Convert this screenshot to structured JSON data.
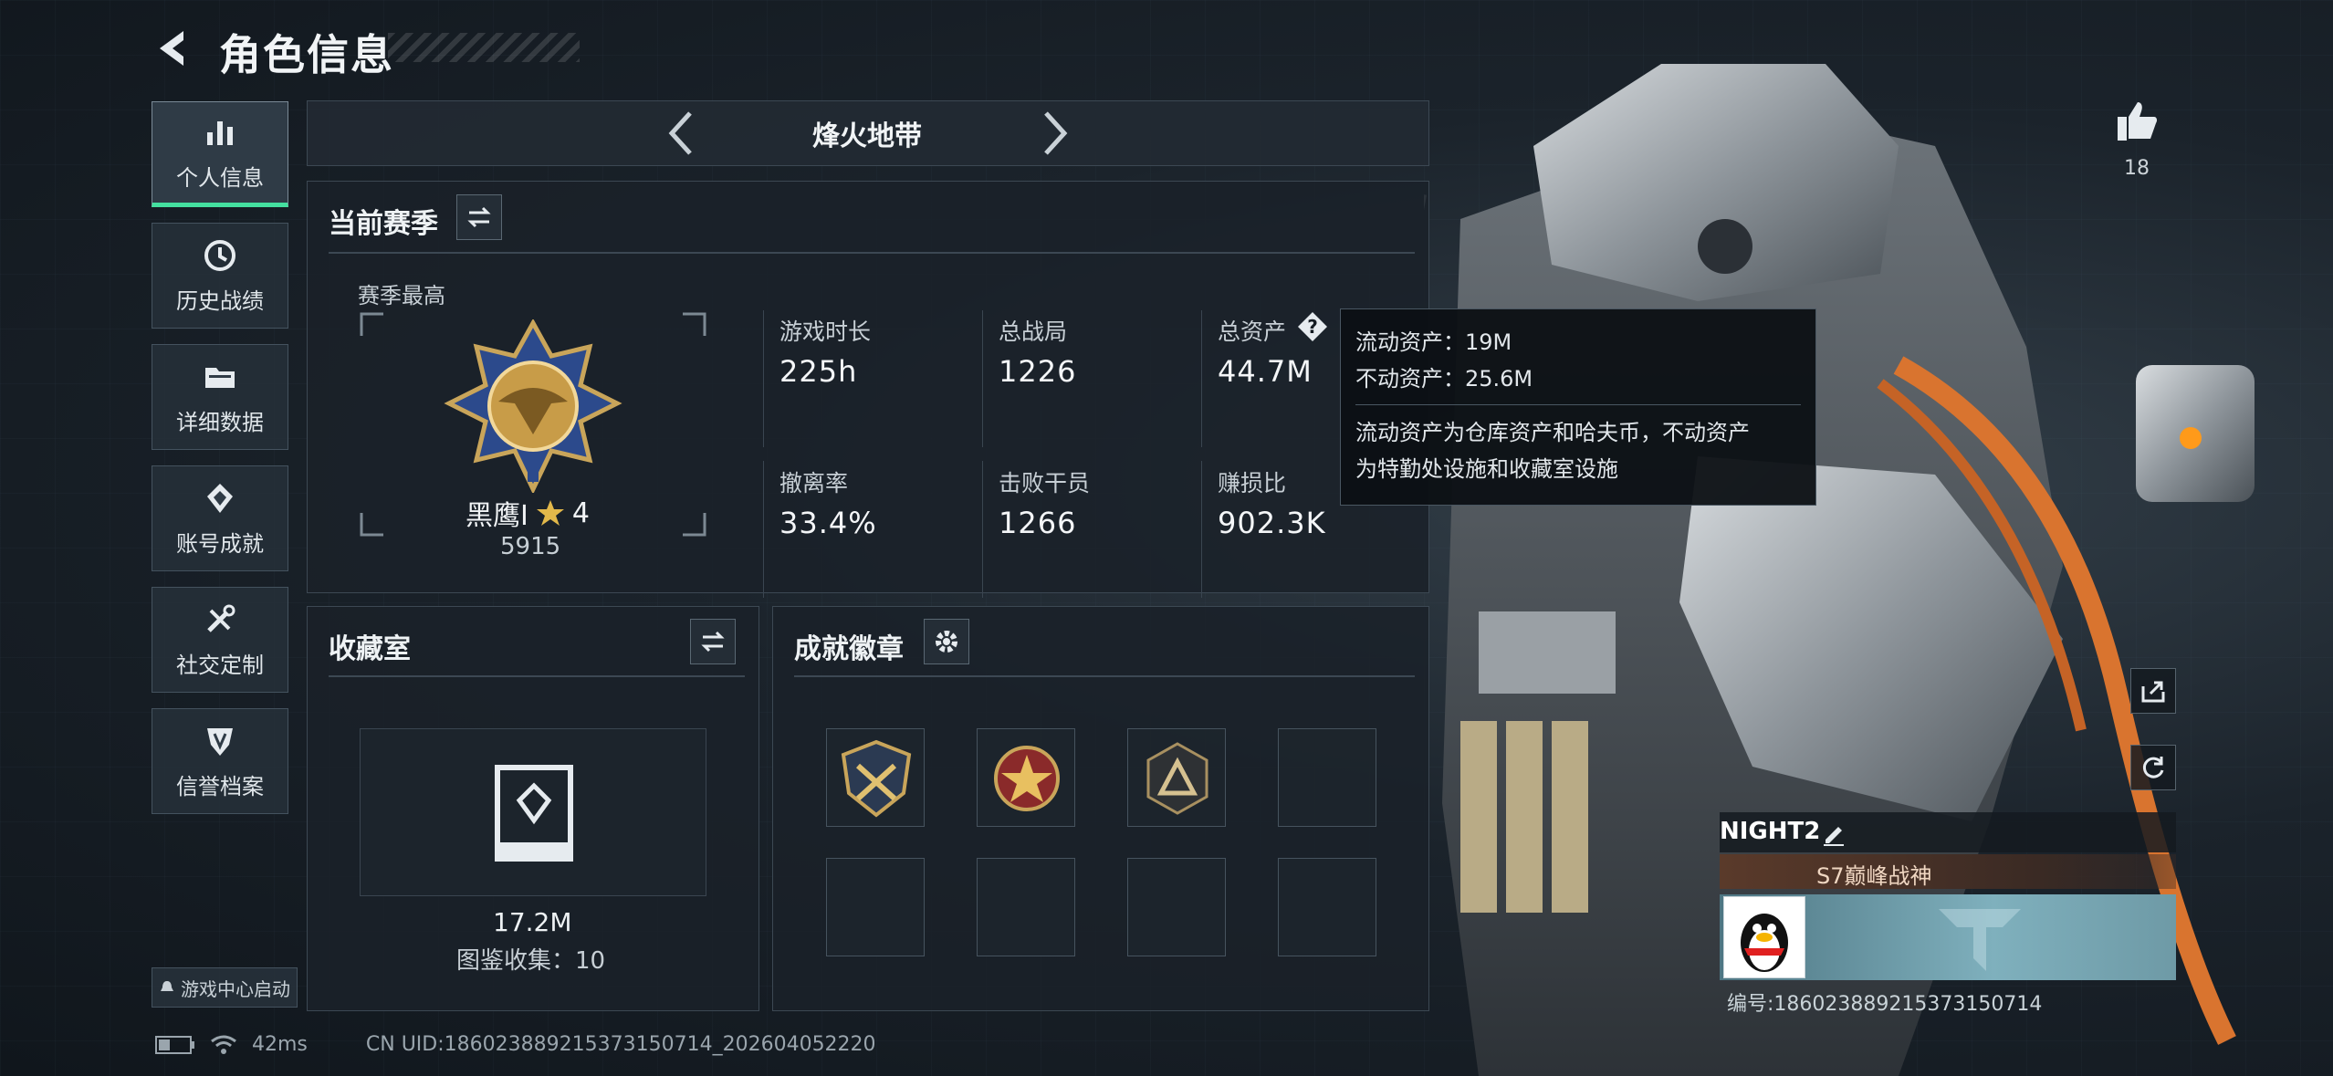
{
  "header": {
    "title": "角色信息"
  },
  "sidebar": {
    "items": [
      {
        "label": "个人信息",
        "icon": "bar-chart-icon",
        "active": true
      },
      {
        "label": "历史战绩",
        "icon": "clock-icon"
      },
      {
        "label": "详细数据",
        "icon": "folder-icon"
      },
      {
        "label": "账号成就",
        "icon": "achievement-icon"
      },
      {
        "label": "社交定制",
        "icon": "tools-icon"
      },
      {
        "label": "信誉档案",
        "icon": "shield-icon"
      }
    ],
    "launch_label": "游戏中心启动"
  },
  "mode": {
    "label": "烽火地带"
  },
  "season": {
    "title": "当前赛季",
    "peak_label": "赛季最高",
    "rank_name": "黑鹰I",
    "rank_stars": "4",
    "rank_points": "5915",
    "stats": [
      {
        "label": "游戏时长",
        "value": "225h"
      },
      {
        "label": "总战局",
        "value": "1226"
      },
      {
        "label": "总资产",
        "value": "44.7M"
      },
      {
        "label": "撤离率",
        "value": "33.4%"
      },
      {
        "label": "击败干员",
        "value": "1266"
      },
      {
        "label": "赚损比",
        "value": "902.3K"
      }
    ]
  },
  "tooltip": {
    "liquid": "流动资产：19M",
    "fixed": "不动资产：25.6M",
    "desc_1": "流动资产为仓库资产和哈夫币，不动资产",
    "desc_2": "为特勤处设施和收藏室设施"
  },
  "collection": {
    "title": "收藏室",
    "value": "17.2M",
    "catalog": "图鉴收集：10"
  },
  "badges": {
    "title": "成就徽章",
    "slots": [
      "badge-crossed-swords",
      "badge-star-wings",
      "badge-triangle",
      "",
      "",
      "",
      "",
      ""
    ]
  },
  "player": {
    "likes": "18",
    "name": "NIGHT2",
    "title": "S7巅峰战神",
    "id": "编号:1860238892153731507​14"
  },
  "status": {
    "ping": "42ms",
    "uid": "CN UID:186023889215373150714_202604052220"
  },
  "colors": {
    "accent": "#44e0a0",
    "tooltip_bg": "#0c1014"
  }
}
